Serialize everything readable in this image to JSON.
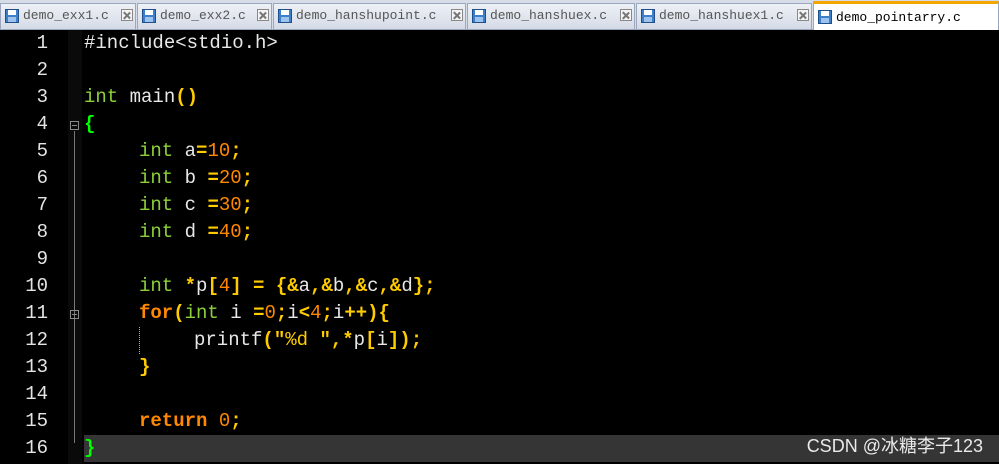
{
  "tabs": [
    {
      "label": "demo_exx1.c",
      "active": false
    },
    {
      "label": "demo_exx2.c",
      "active": false
    },
    {
      "label": "demo_hanshupoint.c",
      "active": false
    },
    {
      "label": "demo_hanshuex.c",
      "active": false
    },
    {
      "label": "demo_hanshuex1.c",
      "active": false
    },
    {
      "label": "demo_pointarry.c",
      "active": true
    }
  ],
  "line_numbers": [
    "1",
    "2",
    "3",
    "4",
    "5",
    "6",
    "7",
    "8",
    "9",
    "10",
    "11",
    "12",
    "13",
    "14",
    "15",
    "16"
  ],
  "code": {
    "l1_pp": "#include<stdio.h>",
    "l3_int": "int",
    "l3_main": " main",
    "l3_paren": "()",
    "l4": "{",
    "l5": [
      "int",
      " a",
      "=",
      "10",
      ";"
    ],
    "l6": [
      "int",
      " b ",
      "=",
      "20",
      ";"
    ],
    "l7": [
      "int",
      " c ",
      "=",
      "30",
      ";"
    ],
    "l8": [
      "int",
      " d ",
      "=",
      "40",
      ";"
    ],
    "l10": [
      "int",
      " ",
      "*",
      "p",
      "[",
      "4",
      "]",
      " = {&",
      "a",
      ",&",
      "b",
      ",&",
      "c",
      ",&",
      "d",
      "};"
    ],
    "l11": [
      "for",
      "(",
      "int",
      " i ",
      "=",
      "0",
      ";",
      "i",
      "<",
      "4",
      ";",
      "i",
      "++){"
    ],
    "l12": [
      "printf",
      "(\"",
      "%d ",
      "\",",
      "*",
      "p",
      "[",
      "i",
      "]);"
    ],
    "l13": "}",
    "l15": [
      "return",
      " ",
      "0",
      ";"
    ],
    "l16": "}"
  },
  "watermark": "CSDN @冰糖李子123",
  "icons": {
    "tab_file": "save-disk-icon",
    "tab_close": "close-icon",
    "fold": "fold-minus-icon"
  }
}
